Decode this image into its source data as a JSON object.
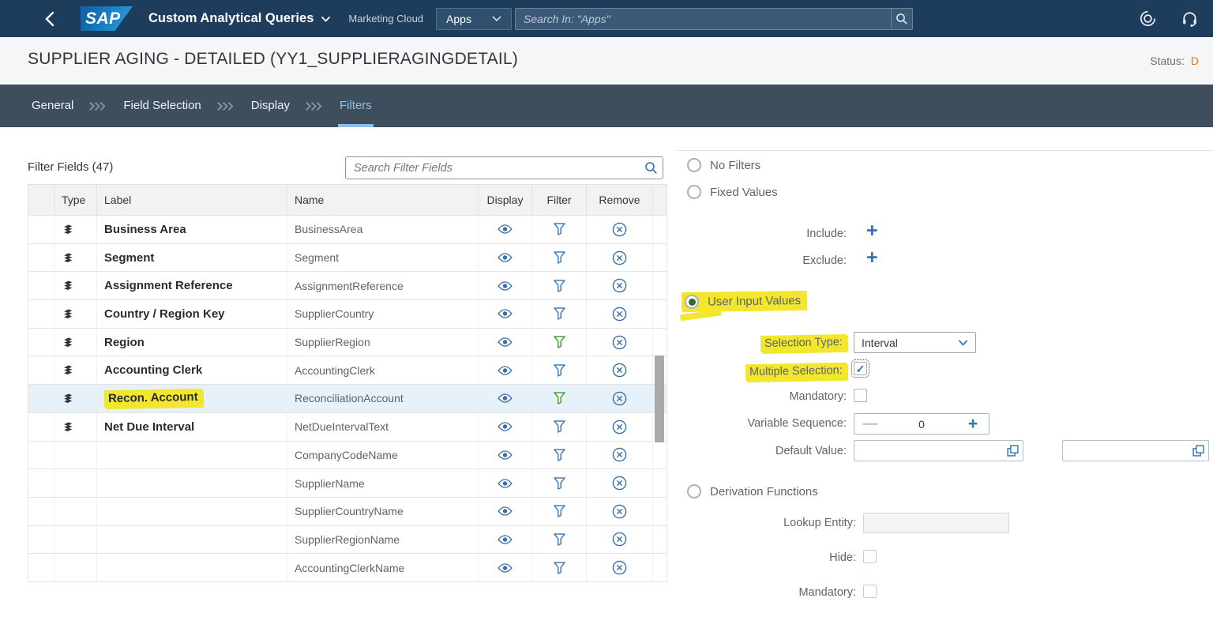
{
  "colors": {
    "accent_blue": "#3273b8",
    "filter_green": "#4f9a3f",
    "highlight_yellow": "#f2e72c",
    "status_orange": "#e9730c",
    "selected_row": "#e7f1fa",
    "topnav_bg": "#1e3c5c",
    "tabbar_bg": "#3e4e5c",
    "active_tab": "#8ec0e9",
    "radio_selected_dot": "#2e6b2e"
  },
  "topnav": {
    "logo": "SAP",
    "app_title": "Custom Analytical Queries",
    "subtitle": "Marketing Cloud",
    "apps_label": "Apps",
    "search_placeholder": "Search In: \"Apps\""
  },
  "header": {
    "title": "SUPPLIER AGING - DETAILED (YY1_SUPPLIERAGINGDETAIL)",
    "status_label": "Status:",
    "status_value": "D"
  },
  "tabs": [
    {
      "label": "General",
      "active": false
    },
    {
      "label": "Field Selection",
      "active": false
    },
    {
      "label": "Display",
      "active": false
    },
    {
      "label": "Filters",
      "active": true
    }
  ],
  "left": {
    "filter_fields_label": "Filter Fields (47)",
    "search_placeholder": "Search Filter Fields",
    "table": {
      "headers": {
        "sel": "",
        "type": "Type",
        "label": "Label",
        "name": "Name",
        "display": "Display",
        "filter": "Filter",
        "remove": "Remove"
      },
      "rows": [
        {
          "type": "dimension",
          "label": "Business Area",
          "name": "BusinessArea",
          "display": "visible",
          "filter": "blue",
          "selected": false,
          "label_highlight": false
        },
        {
          "type": "dimension",
          "label": "Segment",
          "name": "Segment",
          "display": "visible",
          "filter": "blue",
          "selected": false,
          "label_highlight": false
        },
        {
          "type": "dimension",
          "label": "Assignment Reference",
          "name": "AssignmentReference",
          "display": "visible",
          "filter": "blue",
          "selected": false,
          "label_highlight": false
        },
        {
          "type": "dimension",
          "label": "Country / Region Key",
          "name": "SupplierCountry",
          "display": "visible",
          "filter": "blue",
          "selected": false,
          "label_highlight": false
        },
        {
          "type": "dimension",
          "label": "Region",
          "name": "SupplierRegion",
          "display": "visible",
          "filter": "green",
          "selected": false,
          "label_highlight": false
        },
        {
          "type": "dimension",
          "label": "Accounting Clerk",
          "name": "AccountingClerk",
          "display": "visible",
          "filter": "blue",
          "selected": false,
          "label_highlight": false
        },
        {
          "type": "dimension",
          "label": "Recon. Account",
          "name": "ReconciliationAccount",
          "display": "visible",
          "filter": "green",
          "selected": true,
          "label_highlight": true
        },
        {
          "type": "dimension",
          "label": "Net Due Interval",
          "name": "NetDueIntervalText",
          "display": "visible",
          "filter": "blue",
          "selected": false,
          "label_highlight": false
        },
        {
          "type": "",
          "label": "",
          "name": "CompanyCodeName",
          "display": "visible",
          "filter": "blue",
          "selected": false,
          "label_highlight": false
        },
        {
          "type": "",
          "label": "",
          "name": "SupplierName",
          "display": "visible",
          "filter": "blue",
          "selected": false,
          "label_highlight": false
        },
        {
          "type": "",
          "label": "",
          "name": "SupplierCountryName",
          "display": "visible",
          "filter": "blue",
          "selected": false,
          "label_highlight": false
        },
        {
          "type": "",
          "label": "",
          "name": "SupplierRegionName",
          "display": "visible",
          "filter": "blue",
          "selected": false,
          "label_highlight": false
        },
        {
          "type": "",
          "label": "",
          "name": "AccountingClerkName",
          "display": "visible",
          "filter": "blue",
          "selected": false,
          "label_highlight": false
        }
      ]
    }
  },
  "right": {
    "options": {
      "no_filters": "No Filters",
      "fixed_values": "Fixed Values",
      "user_input_values": "User Input Values",
      "derivation_functions": "Derivation Functions",
      "selected": "user_input_values"
    },
    "fixed": {
      "include_label": "Include:",
      "exclude_label": "Exclude:"
    },
    "user_input_fields": {
      "selection_type_label": "Selection Type:",
      "selection_type_value": "Interval",
      "multiple_selection_label": "Multiple Selection:",
      "multiple_selection_checked": true,
      "mandatory_label": "Mandatory:",
      "mandatory_checked": false,
      "variable_sequence_label": "Variable Sequence:",
      "variable_sequence_value": "0",
      "default_value_label": "Default Value:",
      "default_value_1": "",
      "default_value_2": ""
    },
    "derivation_fields": {
      "lookup_entity_label": "Lookup Entity:",
      "lookup_entity_value": "",
      "hide_label": "Hide:",
      "hide_checked": false,
      "mandatory_label": "Mandatory:",
      "mandatory_checked": false
    }
  }
}
